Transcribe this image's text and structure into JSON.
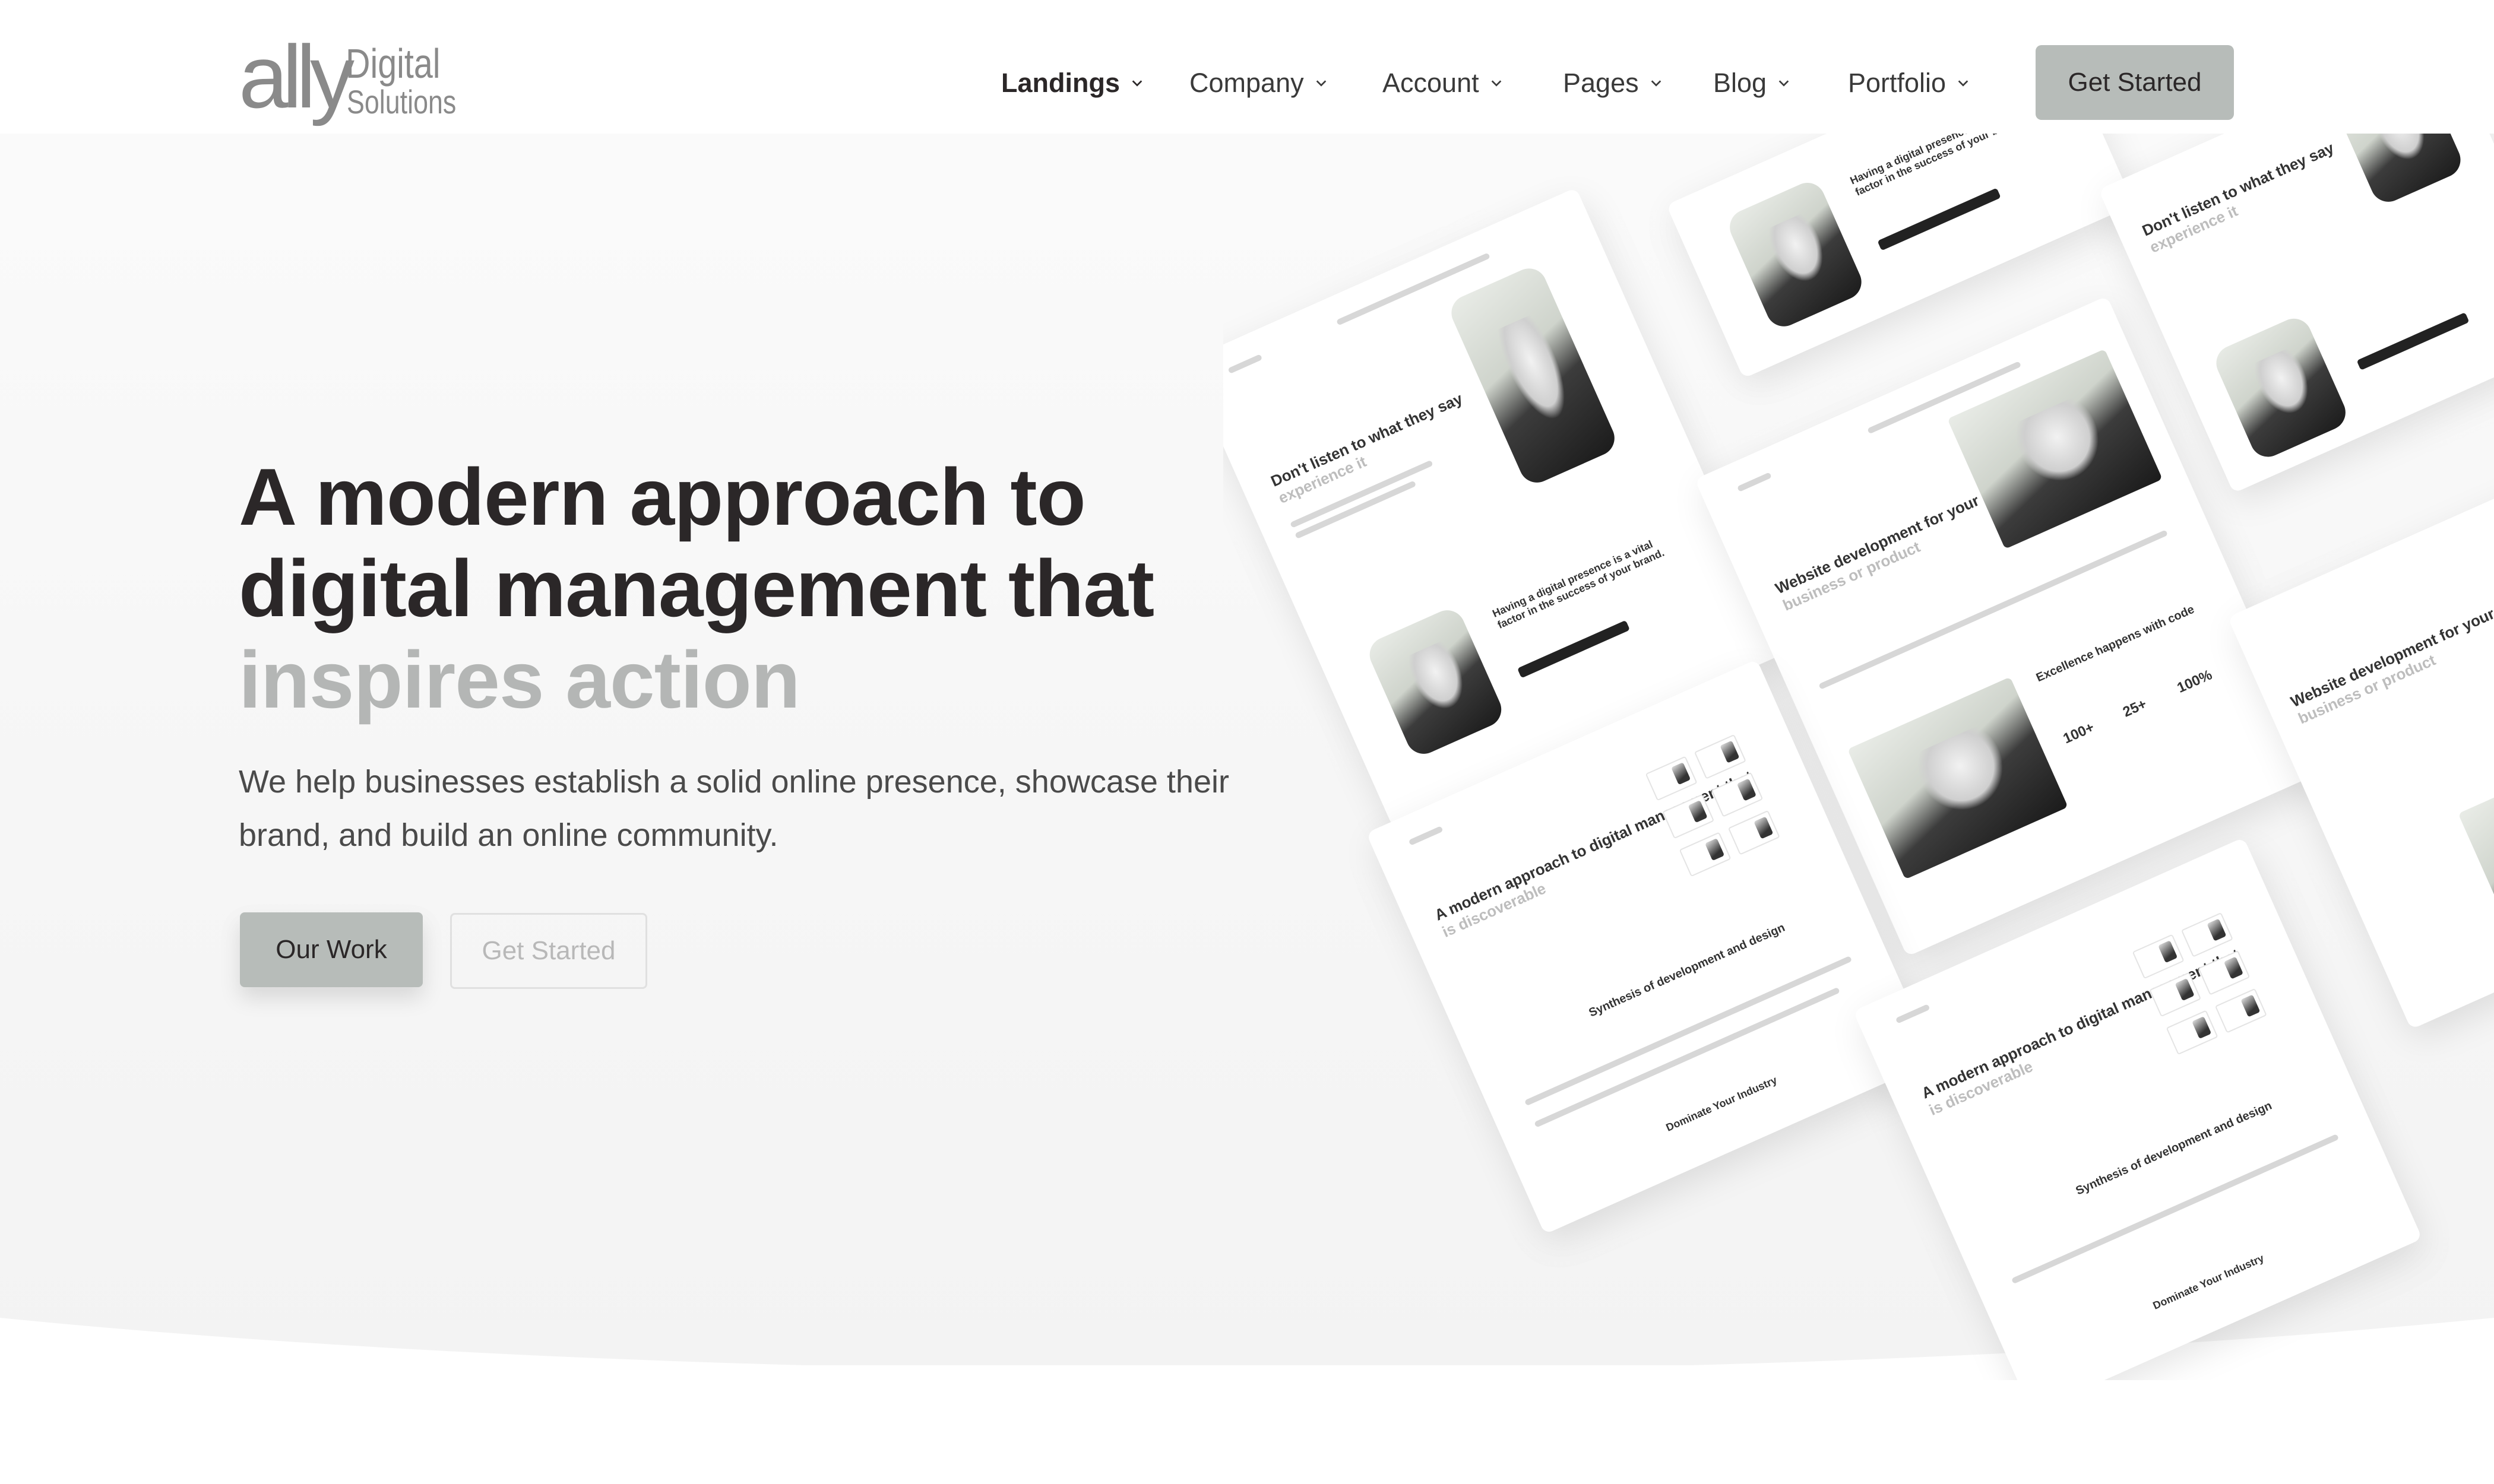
{
  "header": {
    "logo": {
      "primary": "ally",
      "secondary_top": "Digital",
      "secondary_bottom": "Solutions"
    },
    "nav": [
      {
        "label": "Landings",
        "active": true
      },
      {
        "label": "Company",
        "active": false
      },
      {
        "label": "Account",
        "active": false
      },
      {
        "label": "Pages",
        "active": false
      },
      {
        "label": "Blog",
        "active": false
      },
      {
        "label": "Portfolio",
        "active": false
      }
    ],
    "cta_label": "Get Started"
  },
  "hero": {
    "headline_line1": "A modern approach to",
    "headline_line2": "digital management that",
    "headline_accent": "inspires action",
    "subtext": "We help businesses establish a solid online presence, showcase their brand, and build an online community.",
    "primary_button": "Our Work",
    "secondary_button": "Get Started"
  },
  "collage": {
    "titles": {
      "listen": {
        "main": "Don't listen to what they say",
        "accent": "experience it"
      },
      "presence": "Having a digital presence is a vital factor in the success of your brand.",
      "website": {
        "main": "Website development for your",
        "accent": "business or product"
      },
      "excellence": "Excellence happens with code",
      "modern": {
        "main": "A modern approach to digital management that",
        "accent": "is discoverable"
      },
      "synthesis": "Synthesis of development and design",
      "dominate": "Dominate Your Industry"
    },
    "stats": [
      "100+",
      "25+",
      "100%"
    ]
  },
  "colors": {
    "accent_button": "#b7bcb9",
    "headline": "#2b2728",
    "headline_accent": "#b4b6b5",
    "background": "#f7f7f7"
  }
}
